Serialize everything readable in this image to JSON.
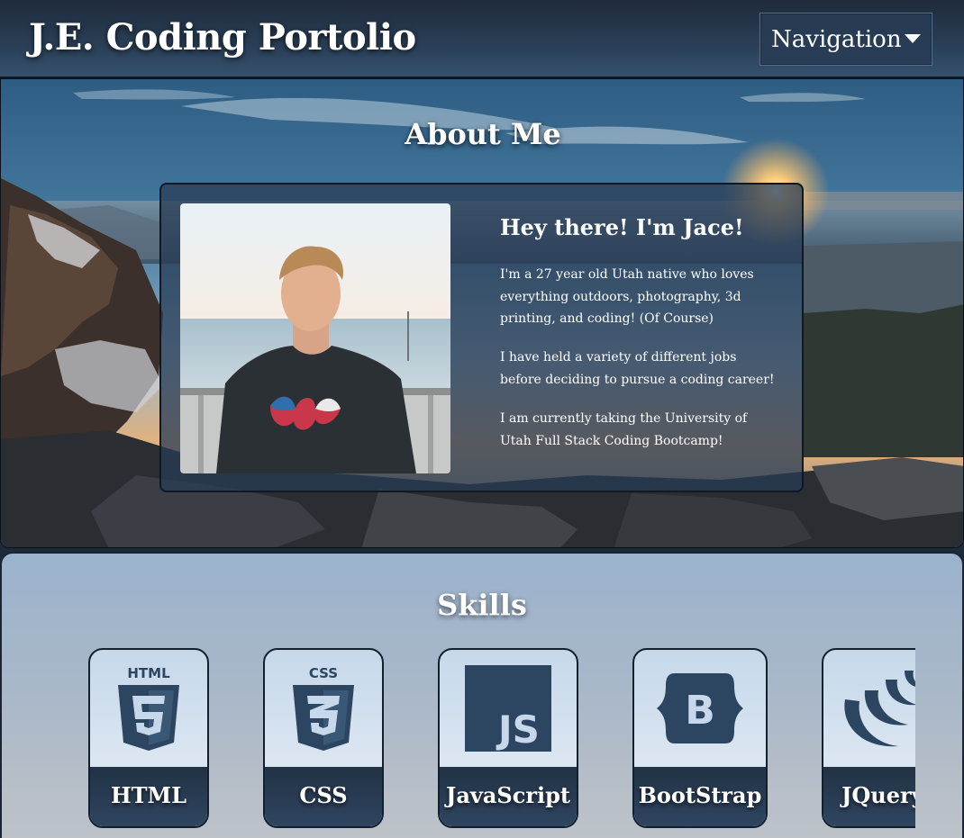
{
  "header": {
    "title": "J.E. Coding Portolio",
    "nav_label": "Navigation"
  },
  "about": {
    "heading": "About Me",
    "greeting": "Hey there! I'm Jace!",
    "paragraphs": [
      "I'm a 27 year old Utah native who loves everything outdoors, photography, 3d printing, and coding! (Of Course)",
      "I have held a variety of different jobs before deciding to pursue a coding career!",
      "I am currently taking the University of Utah Full Stack Coding Bootcamp!"
    ]
  },
  "skills": {
    "heading": "Skills",
    "items": [
      {
        "label": "HTML",
        "icon": "html5-icon"
      },
      {
        "label": "CSS",
        "icon": "css3-icon"
      },
      {
        "label": "JavaScript",
        "icon": "javascript-icon"
      },
      {
        "label": "BootStrap",
        "icon": "bootstrap-icon"
      },
      {
        "label": "JQuery",
        "icon": "jquery-icon"
      }
    ]
  },
  "colors": {
    "header_bg": "#2a3f57",
    "card_bg": "#283c55",
    "skill_label_bg": "#223245",
    "icon_color": "#2c4560"
  }
}
